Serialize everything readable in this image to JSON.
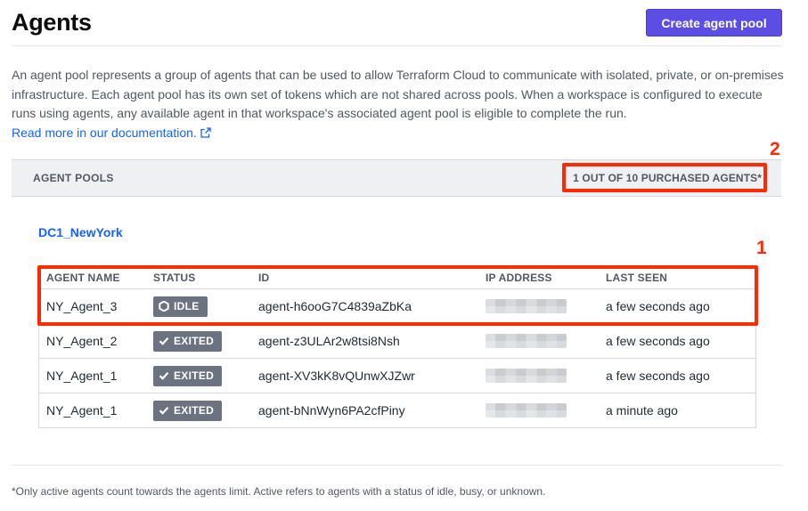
{
  "header": {
    "title": "Agents",
    "create_button": "Create agent pool"
  },
  "description": {
    "text": "An agent pool represents a group of agents that can be used to allow Terraform Cloud to communicate with isolated, private, or on-premises infrastructure. Each agent pool has its own set of tokens which are not shared across pools. When a workspace is configured to execute runs using agents, any available agent in that workspace's associated agent pool is eligible to complete the run.",
    "link_text": "Read more in our documentation."
  },
  "pools_bar": {
    "label": "AGENT POOLS",
    "purchased": "1 OUT OF 10 PURCHASED AGENTS*"
  },
  "annotations": {
    "marker_1": "1",
    "marker_2": "2"
  },
  "pool": {
    "name": "DC1_NewYork",
    "columns": [
      "AGENT NAME",
      "STATUS",
      "ID",
      "IP ADDRESS",
      "LAST SEEN"
    ],
    "agents": [
      {
        "name": "NY_Agent_3",
        "status": "IDLE",
        "status_icon": "hexagon-icon",
        "id": "agent-h6ooG7C4839aZbKa",
        "last_seen": "a few seconds ago"
      },
      {
        "name": "NY_Agent_2",
        "status": "EXITED",
        "status_icon": "check-icon",
        "id": "agent-z3ULAr2w8tsi8Nsh",
        "last_seen": "a few seconds ago"
      },
      {
        "name": "NY_Agent_1",
        "status": "EXITED",
        "status_icon": "check-icon",
        "id": "agent-XV3kK8vQUnwXJZwr",
        "last_seen": "a few seconds ago"
      },
      {
        "name": "NY_Agent_1",
        "status": "EXITED",
        "status_icon": "check-icon",
        "id": "agent-bNnWyn6PA2cfPiny",
        "last_seen": "a minute ago"
      }
    ]
  },
  "footnote": "*Only active agents count towards the agents limit. Active refers to agents with a status of idle, busy, or unknown.",
  "colors": {
    "primary_button": "#5c4ee5",
    "link": "#1563ff",
    "badge": "#6b7280",
    "highlight": "#ff2a00"
  }
}
